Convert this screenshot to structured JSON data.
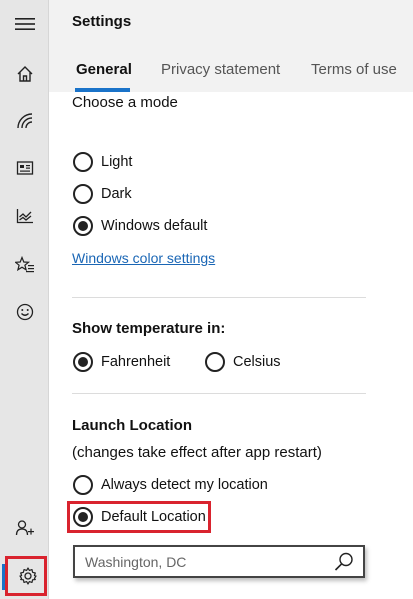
{
  "app": {
    "title": "Settings"
  },
  "tabs": [
    {
      "label": "General",
      "active": true
    },
    {
      "label": "Privacy statement",
      "active": false
    },
    {
      "label": "Terms of use",
      "active": false
    }
  ],
  "rail": {
    "items": [
      "menu-icon",
      "home-icon",
      "news-icon",
      "newspaper-icon",
      "chart-icon",
      "favorites-icon",
      "smiley-icon",
      "add-user-icon",
      "gear-icon"
    ]
  },
  "mode": {
    "heading": "Choose a mode",
    "options": [
      {
        "label": "Light",
        "checked": false
      },
      {
        "label": "Dark",
        "checked": false
      },
      {
        "label": "Windows default",
        "checked": true
      }
    ],
    "link": "Windows color settings"
  },
  "temperature": {
    "heading": "Show temperature in:",
    "options": [
      {
        "label": "Fahrenheit",
        "checked": true
      },
      {
        "label": "Celsius",
        "checked": false
      }
    ]
  },
  "launch": {
    "heading": "Launch Location",
    "note": "(changes take effect after app restart)",
    "options": [
      {
        "label": "Always detect my location",
        "checked": false
      },
      {
        "label": "Default Location",
        "checked": true
      }
    ],
    "search_value": "Washington, DC"
  },
  "colors": {
    "accent": "#1a73c9",
    "highlight": "#d9232e"
  }
}
